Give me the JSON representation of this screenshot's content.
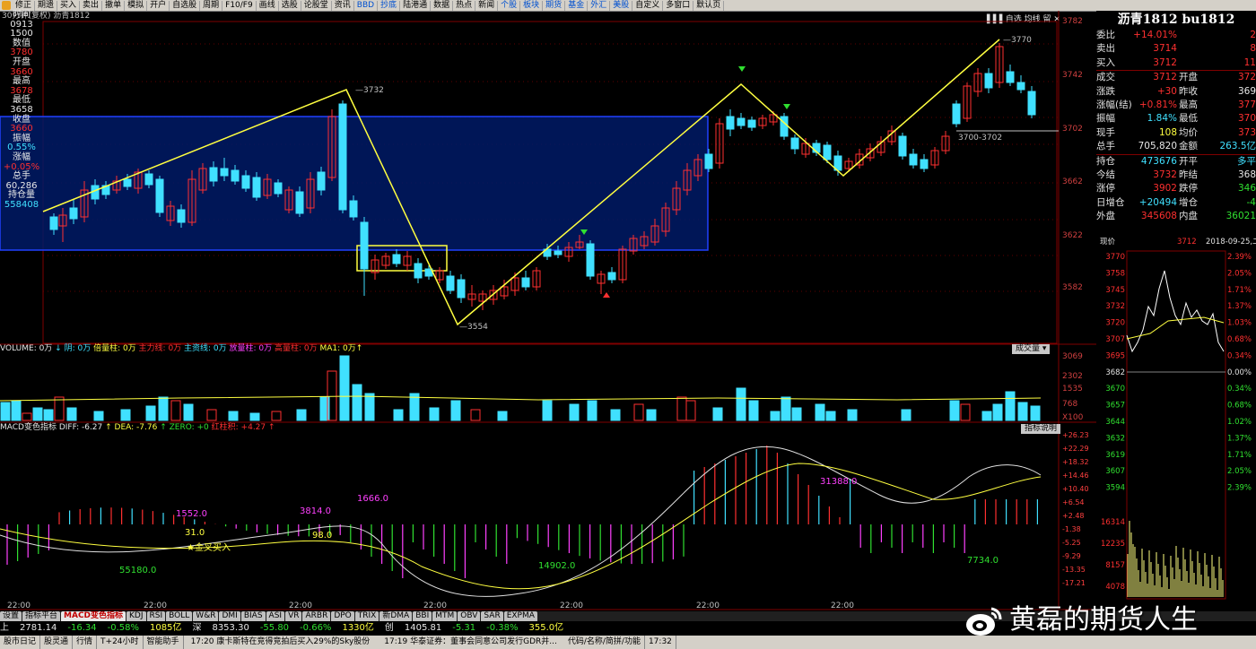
{
  "toolbar": [
    "修正",
    "期遗",
    "买入",
    "卖出",
    "撤单",
    "模拟",
    "开户",
    "自选股",
    "周期",
    "F10/F9",
    "画线",
    "选股",
    "论股堂",
    "资讯",
    "BBD",
    "抄底",
    "陆港通",
    "数据",
    "热点",
    "新闻",
    "个股",
    "板块",
    "期货",
    "基金",
    "外汇",
    "美股",
    "自定义",
    "多窗口",
    "默认页"
  ],
  "chart_title": "30分钟(复权) 沥青1812",
  "top_buttons": "▌▌▌自选 均线 留 ✕",
  "left_panel": [
    {
      "t": "时间",
      "c": "white"
    },
    {
      "t": "0913",
      "c": "white"
    },
    {
      "t": "1500",
      "c": "white"
    },
    {
      "t": "数值",
      "c": "white"
    },
    {
      "t": "3780",
      "c": "red"
    },
    {
      "t": "开盘",
      "c": "white"
    },
    {
      "t": "3660",
      "c": "red"
    },
    {
      "t": "最高",
      "c": "white"
    },
    {
      "t": "3678",
      "c": "red"
    },
    {
      "t": "最低",
      "c": "white"
    },
    {
      "t": "3658",
      "c": "white"
    },
    {
      "t": "收盘",
      "c": "white"
    },
    {
      "t": "3660",
      "c": "red"
    },
    {
      "t": "振幅",
      "c": "white"
    },
    {
      "t": "0.55%",
      "c": "cyan"
    },
    {
      "t": "涨幅",
      "c": "white"
    },
    {
      "t": "+0.05%",
      "c": "red"
    },
    {
      "t": "总手",
      "c": "white"
    },
    {
      "t": "60,286",
      "c": "white"
    },
    {
      "t": "持仓量",
      "c": "white"
    },
    {
      "t": "558408",
      "c": "cyan"
    }
  ],
  "price_axis": [
    "3782",
    "3742",
    "3702",
    "3662",
    "3622",
    "3582"
  ],
  "annotations": {
    "high1": "3732",
    "low1": "3554",
    "high2": "3770",
    "range": "3700-3702"
  },
  "vol_header": [
    {
      "t": "VOLUME: 0万",
      "c": "white"
    },
    {
      "t": "↓ 阴: 0万",
      "c": "cyan"
    },
    {
      "t": "倍量柱: 0万",
      "c": "yellow"
    },
    {
      "t": "主力线: 0万",
      "c": "red"
    },
    {
      "t": "主资线: 0万",
      "c": "cyan"
    },
    {
      "t": "放量柱: 0万",
      "c": "mag"
    },
    {
      "t": "高量柱: 0万",
      "c": "red"
    },
    {
      "t": "MA1: 0万↑",
      "c": "yellow"
    }
  ],
  "vol_button": "成交量 ▾",
  "vol_axis": [
    "3069",
    "2302",
    "1535",
    "768",
    "X100"
  ],
  "macd_header": [
    {
      "t": "MACD变色指标 DIFF: -6.27",
      "c": "white"
    },
    {
      "t": "↑ DEA: -7.76",
      "c": "yellow"
    },
    {
      "t": "↑ ZERO: +0",
      "c": "green"
    },
    {
      "t": "红柱积: +4.27",
      "c": "red"
    },
    {
      "t": "↑",
      "c": "red"
    }
  ],
  "macd_button": "指标说明",
  "macd_axis": [
    "+26.23",
    "+22.29",
    "+18.32",
    "+14.46",
    "+10.40",
    "+6.54",
    "+2.48",
    "-1.38",
    "-5.25",
    "-9.29",
    "-13.35",
    "-17.21"
  ],
  "macd_labels": {
    "a": "1552.0",
    "b": "31.0",
    "c": "3814.0",
    "d": "98.0",
    "e": "1666.0",
    "f": "55180.0",
    "g": "14902.0",
    "h": "31388.0",
    "i": "7734.0",
    "gold": "★金叉买入"
  },
  "time_axis": [
    "22:00",
    "22:00",
    "22:00",
    "22:00",
    "22:00",
    "22:00",
    "22:00"
  ],
  "right_panel": {
    "title": "沥青1812 bu1812",
    "rows": [
      {
        "l1": "委比",
        "v1": "+14.01%",
        "c1": "red",
        "l2": "",
        "v2": "2",
        "c2": "red"
      },
      {
        "l1": "卖出",
        "v1": "3714",
        "c1": "red",
        "l2": "",
        "v2": "8",
        "c2": "red"
      },
      {
        "l1": "买入",
        "v1": "3712",
        "c1": "red",
        "l2": "",
        "v2": "11",
        "c2": "red"
      },
      {
        "l1": "成交",
        "v1": "3712",
        "c1": "red",
        "l2": "开盘",
        "v2": "372",
        "c2": "red"
      },
      {
        "l1": "涨跌",
        "v1": "+30",
        "c1": "red",
        "l2": "昨收",
        "v2": "369",
        "c2": "white"
      },
      {
        "l1": "涨幅(结)",
        "v1": "+0.81%",
        "c1": "red",
        "l2": "最高",
        "v2": "377",
        "c2": "red"
      },
      {
        "l1": "振幅",
        "v1": "1.84%",
        "c1": "cyan",
        "l2": "最低",
        "v2": "370",
        "c2": "red"
      },
      {
        "l1": "现手",
        "v1": "108",
        "c1": "yellow",
        "l2": "均价",
        "v2": "373",
        "c2": "red"
      },
      {
        "l1": "总手",
        "v1": "705,820",
        "c1": "white",
        "l2": "金额",
        "v2": "263.5亿",
        "c2": "cyan"
      },
      {
        "l1": "持仓",
        "v1": "473676",
        "c1": "cyan",
        "l2": "开平",
        "v2": "多平",
        "c2": "cyan"
      },
      {
        "l1": "今结",
        "v1": "3732",
        "c1": "red",
        "l2": "昨结",
        "v2": "368",
        "c2": "white"
      },
      {
        "l1": "涨停",
        "v1": "3902",
        "c1": "red",
        "l2": "跌停",
        "v2": "346",
        "c2": "green"
      },
      {
        "l1": "日增仓",
        "v1": "+20494",
        "c1": "cyan",
        "l2": "增仓",
        "v2": "-4",
        "c2": "green"
      },
      {
        "l1": "外盘",
        "v1": "345608",
        "c1": "red",
        "l2": "内盘",
        "v2": "36021",
        "c2": "green"
      }
    ]
  },
  "mini_chart": {
    "header_label": "现价",
    "header_price": "3712",
    "header_date": "2018-09-25,二",
    "left_axis": [
      "3770",
      "3758",
      "3745",
      "3732",
      "3720",
      "3707",
      "3695",
      "3682",
      "3670",
      "3657",
      "3644",
      "3632",
      "3619",
      "3607",
      "3594",
      "16314",
      "12235",
      "8157",
      "4078"
    ],
    "right_axis": [
      "2.39%",
      "2.05%",
      "1.71%",
      "1.37%",
      "1.03%",
      "0.68%",
      "0.34%",
      "0.00%",
      "0.34%",
      "0.68%",
      "1.02%",
      "1.37%",
      "1.71%",
      "2.05%",
      "2.39%"
    ]
  },
  "tabs": [
    "设置",
    "指标平台",
    "MACD变色指标",
    "KDJ",
    "RSI",
    "BOLL",
    "W&R",
    "DMI",
    "BIAS",
    "ASI",
    "VR",
    "ARBR",
    "DPO",
    "TRIX",
    "新DMA",
    "BBI",
    "MTM",
    "OBV",
    "SAR",
    "EXPMA"
  ],
  "status1": [
    {
      "t": "上",
      "c": "white"
    },
    {
      "t": "2781.14",
      "c": "white"
    },
    {
      "t": "-16.34",
      "c": "green"
    },
    {
      "t": "-0.58%",
      "c": "green"
    },
    {
      "t": "1085亿",
      "c": "yellow"
    },
    {
      "t": "深",
      "c": "white"
    },
    {
      "t": "8353.30",
      "c": "white"
    },
    {
      "t": "-55.80",
      "c": "green"
    },
    {
      "t": "-0.66%",
      "c": "green"
    },
    {
      "t": "1330亿",
      "c": "yellow"
    },
    {
      "t": "创",
      "c": "white"
    },
    {
      "t": "1405.81",
      "c": "white"
    },
    {
      "t": "-5.31",
      "c": "green"
    },
    {
      "t": "-0.38%",
      "c": "green"
    },
    {
      "t": "355.0亿",
      "c": "yellow"
    }
  ],
  "status2_left": [
    "股市日记",
    "股灵通",
    "行情",
    "T+24小时",
    "智能助手"
  ],
  "news1": "17:20 康卡斯特在竞得竞拍后买入29%的Sky股份",
  "news2": "17:19 华泰证券：董事会同意公司发行GDR并...",
  "status2_right": [
    "代码/名称/简拼/功能",
    "17:32"
  ],
  "watermark": "黄磊的期货人生"
}
